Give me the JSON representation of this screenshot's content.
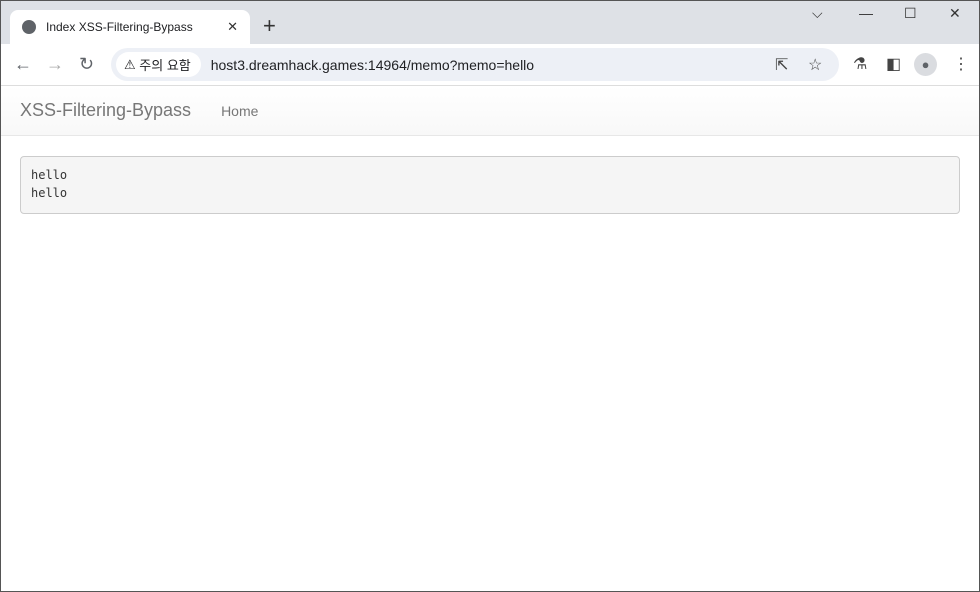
{
  "browser": {
    "tab_title": "Index XSS-Filtering-Bypass",
    "security_label": "주의 요함",
    "url": "host3.dreamhack.games:14964/memo?memo=hello"
  },
  "navbar": {
    "brand": "XSS-Filtering-Bypass",
    "home": "Home"
  },
  "memo": {
    "lines": [
      "hello",
      "hello"
    ]
  }
}
